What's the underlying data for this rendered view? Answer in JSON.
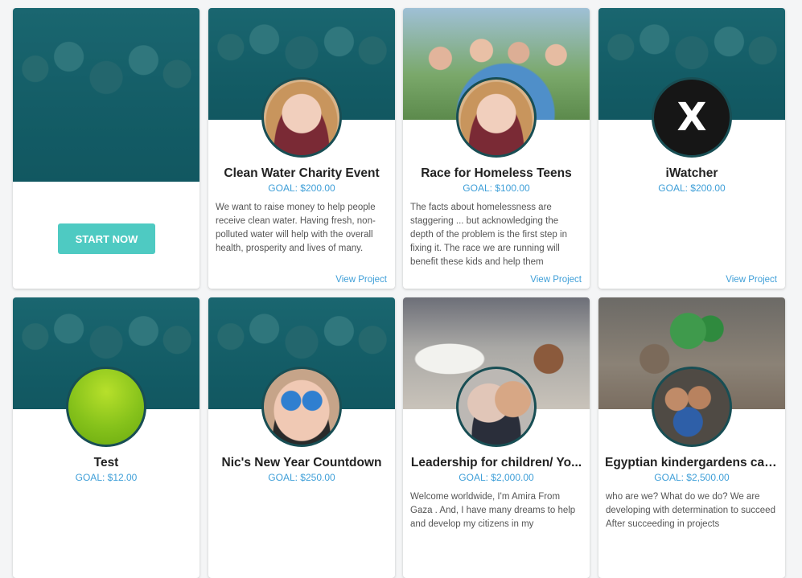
{
  "cta_card": {
    "button_label": "START NOW"
  },
  "projects": [
    {
      "title": "Clean Water Charity Event",
      "goal": "GOAL: $200.00",
      "description": "We want to raise money to help people receive clean water. Having fresh, non-polluted water will help with the overall health, prosperity and lives of many.",
      "link": "View Project"
    },
    {
      "title": "Race for Homeless Teens",
      "goal": "GOAL: $100.00",
      "description": "The facts about homelessness are staggering ... but acknowledging the depth of the problem is the first step in fixing it. The race we are running will benefit these kids and help them",
      "link": "View Project"
    },
    {
      "title": "iWatcher",
      "goal": "GOAL: $200.00",
      "description": "",
      "link": "View Project",
      "logo_glyph": "X"
    },
    {
      "title": "Test",
      "goal": "GOAL: $12.00",
      "description": ""
    },
    {
      "title": "Nic's New Year Countdown",
      "goal": "GOAL: $250.00",
      "description": ""
    },
    {
      "title": "Leadership for children/ Yo...",
      "goal": "GOAL: $2,000.00",
      "description": "Welcome worldwide, I'm Amira From Gaza . And, I have many dreams to help and develop my citizens in my"
    },
    {
      "title": "Egyptian kindergardens car...",
      "goal": "GOAL: $2,500.00",
      "description": "who are we? What do we do? We are developing with determination to succeed After succeeding in projects"
    }
  ],
  "colors": {
    "accent_teal": "#4ecac2",
    "link_blue": "#3f9fd8",
    "avatar_border": "#184e54"
  }
}
